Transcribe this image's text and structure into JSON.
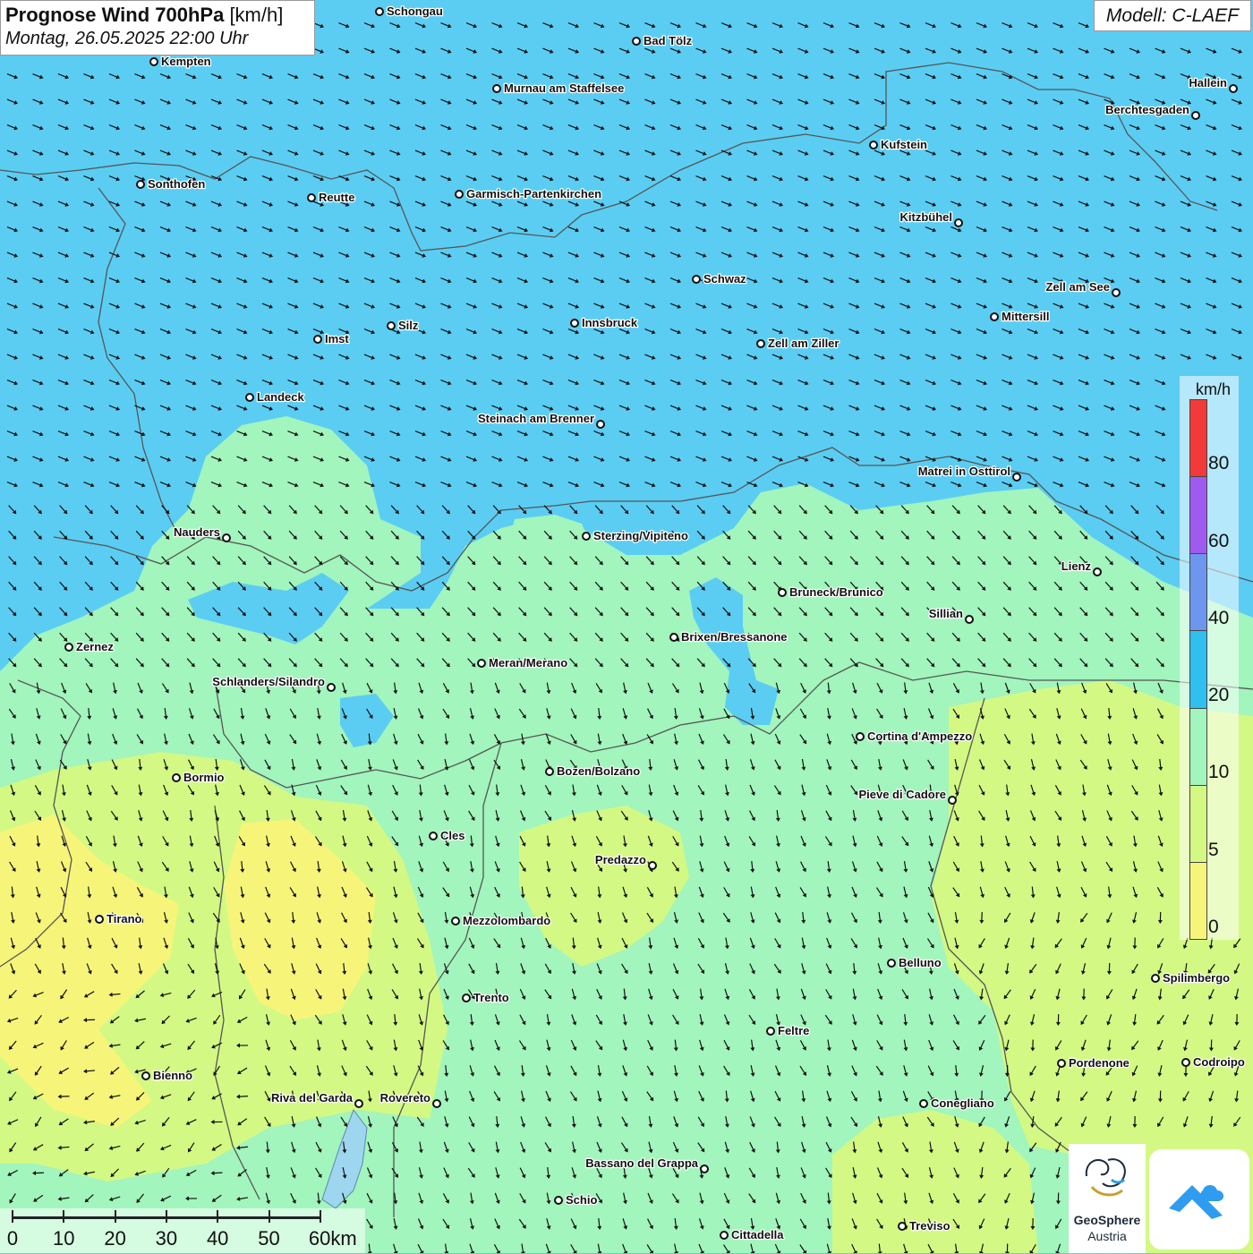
{
  "title": {
    "main": "Prognose Wind 700hPa",
    "unit": "[km/h]",
    "datetime": "Montag, 26.05.2025 22:00 Uhr"
  },
  "model": "Modell: C-LAEF",
  "colors": {
    "zone_strong": "#5bcdf3",
    "zone_moderate": "#a2f5bc",
    "zone_weak": "#d3f984",
    "zone_calm": "#f6f57a",
    "border": "#555555",
    "arrow": "#111111"
  },
  "legend": {
    "unit": "km/h",
    "classes": [
      {
        "range": "0-5",
        "color": "#f6f57a"
      },
      {
        "range": "5-10",
        "color": "#d3f984"
      },
      {
        "range": "10-20",
        "color": "#a2f5bc"
      },
      {
        "range": "20-40",
        "color": "#2fc0f0"
      },
      {
        "range": "40-60",
        "color": "#6d97ee"
      },
      {
        "range": "60-80",
        "color": "#a05af0"
      },
      {
        "range": "80+",
        "color": "#f23a3a"
      }
    ],
    "labels": [
      "0",
      "5",
      "10",
      "20",
      "40",
      "60",
      "80"
    ]
  },
  "scale_bar": {
    "labels": [
      "0",
      "10",
      "20",
      "30",
      "40",
      "50",
      "60km"
    ]
  },
  "logos": {
    "brand": "GeoSphere",
    "sub": "Austria"
  },
  "cities": [
    {
      "name": "Schongau",
      "label_side": "right"
    },
    {
      "name": "Bad Tölz",
      "label_side": "right"
    },
    {
      "name": "Kempten",
      "label_side": "right"
    },
    {
      "name": "Murnau am Staffelsee",
      "label_side": "right"
    },
    {
      "name": "Hallein",
      "label_side": "left"
    },
    {
      "name": "Berchtesgaden",
      "label_side": "left"
    },
    {
      "name": "Kufstein",
      "label_side": "right"
    },
    {
      "name": "Sonthofen",
      "label_side": "right"
    },
    {
      "name": "Reutte",
      "label_side": "right"
    },
    {
      "name": "Garmisch-Partenkirchen",
      "label_side": "right"
    },
    {
      "name": "Kitzbühel",
      "label_side": "left"
    },
    {
      "name": "Schwaz",
      "label_side": "right"
    },
    {
      "name": "Zell am See",
      "label_side": "left"
    },
    {
      "name": "Innsbruck",
      "label_side": "right"
    },
    {
      "name": "Mittersill",
      "label_side": "right"
    },
    {
      "name": "Silz",
      "label_side": "right"
    },
    {
      "name": "Imst",
      "label_side": "right"
    },
    {
      "name": "Zell am Ziller",
      "label_side": "right"
    },
    {
      "name": "Landeck",
      "label_side": "right"
    },
    {
      "name": "Steinach am Brenner",
      "label_side": "left"
    },
    {
      "name": "Matrei in Osttirol",
      "label_side": "left"
    },
    {
      "name": "Nauders",
      "label_side": "left"
    },
    {
      "name": "Sterzing/Vipiteno",
      "label_side": "right"
    },
    {
      "name": "Lienz",
      "label_side": "left"
    },
    {
      "name": "Bruneck/Brunico",
      "label_side": "right"
    },
    {
      "name": "Sillian",
      "label_side": "left"
    },
    {
      "name": "Zernez",
      "label_side": "right"
    },
    {
      "name": "Brixen/Bressanone",
      "label_side": "right"
    },
    {
      "name": "Meran/Merano",
      "label_side": "right"
    },
    {
      "name": "Schlanders/Silandro",
      "label_side": "left"
    },
    {
      "name": "Cortina d'Ampezzo",
      "label_side": "right"
    },
    {
      "name": "Bozen/Bolzano",
      "label_side": "right"
    },
    {
      "name": "Bormio",
      "label_side": "right"
    },
    {
      "name": "Pieve di Cadore",
      "label_side": "left"
    },
    {
      "name": "Cles",
      "label_side": "right"
    },
    {
      "name": "Predazzo",
      "label_side": "left"
    },
    {
      "name": "Tirano",
      "label_side": "right"
    },
    {
      "name": "Mezzolombardo",
      "label_side": "right"
    },
    {
      "name": "Belluno",
      "label_side": "right"
    },
    {
      "name": "Spilimbergo",
      "label_side": "right"
    },
    {
      "name": "Trento",
      "label_side": "right"
    },
    {
      "name": "Feltre",
      "label_side": "right"
    },
    {
      "name": "Pordenone",
      "label_side": "right"
    },
    {
      "name": "Codroipo",
      "label_side": "right"
    },
    {
      "name": "Bienno",
      "label_side": "right"
    },
    {
      "name": "Riva del Garda",
      "label_side": "left"
    },
    {
      "name": "Rovereto",
      "label_side": "left"
    },
    {
      "name": "Conegliano",
      "label_side": "right"
    },
    {
      "name": "Bassano del Grappa",
      "label_side": "left"
    },
    {
      "name": "Schio",
      "label_side": "right"
    },
    {
      "name": "Treviso",
      "label_side": "right"
    },
    {
      "name": "Cittadella",
      "label_side": "right"
    }
  ]
}
